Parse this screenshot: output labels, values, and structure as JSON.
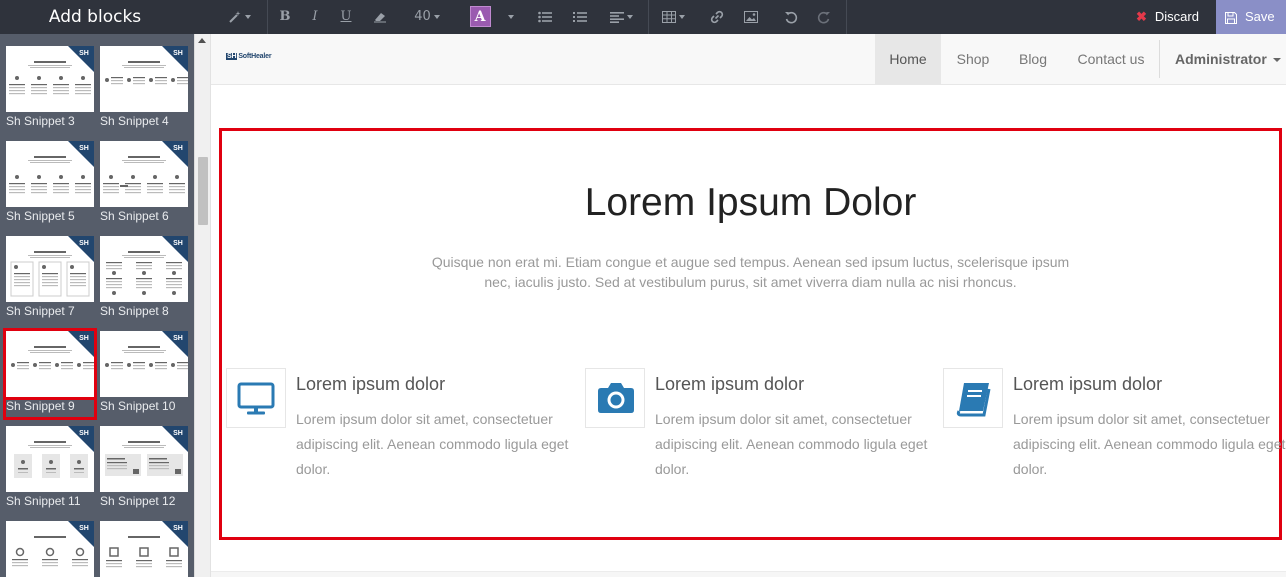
{
  "sidebar": {
    "title": "Add blocks",
    "snippets": [
      {
        "label": "Sh Snippet 3"
      },
      {
        "label": "Sh Snippet 4"
      },
      {
        "label": "Sh Snippet 5"
      },
      {
        "label": "Sh Snippet 6"
      },
      {
        "label": "Sh Snippet 7"
      },
      {
        "label": "Sh Snippet 8"
      },
      {
        "label": "Sh Snippet 9",
        "selected": true
      },
      {
        "label": "Sh Snippet 10"
      },
      {
        "label": "Sh Snippet 11"
      },
      {
        "label": "Sh Snippet 12"
      },
      {
        "label": ""
      },
      {
        "label": ""
      }
    ],
    "badge_text": "SH"
  },
  "toolbar": {
    "font_size": "40",
    "font_color_letter": "A",
    "discard_label": "Discard",
    "save_label": "Save",
    "colors": {
      "font_color": "#9a5bb0",
      "save_bg": "#8a8fc7",
      "discard_icon": "#e4394a"
    }
  },
  "navbar": {
    "logo_mark": "SH",
    "logo_text": "SoftHealer",
    "items": [
      {
        "label": "Home",
        "active": true
      },
      {
        "label": "Shop"
      },
      {
        "label": "Blog"
      },
      {
        "label": "Contact us"
      }
    ],
    "user_menu": "Administrator"
  },
  "block": {
    "title": "Lorem Ipsum Dolor",
    "text": "Quisque non erat mi. Etiam congue et augue sed tempus. Aenean sed ipsum luctus, scelerisque ipsum nec, iaculis justo. Sed at vestibulum purus, sit amet viverra diam nulla ac nisi rhoncus.",
    "features": [
      {
        "icon": "desktop-icon",
        "title": "Lorem ipsum dolor",
        "text": "Lorem ipsum dolor sit amet, consectetuer adipiscing elit. Aenean commodo ligula eget dolor."
      },
      {
        "icon": "camera-icon",
        "title": "Lorem ipsum dolor",
        "text": "Lorem ipsum dolor sit amet, consectetuer adipiscing elit. Aenean commodo ligula eget dolor."
      },
      {
        "icon": "book-icon",
        "title": "Lorem ipsum dolor",
        "text": "Lorem ipsum dolor sit amet, consectetuer adipiscing elit. Aenean commodo ligula eget dolor."
      }
    ],
    "colors": {
      "icon": "#2a7ab3",
      "selection_outline": "#e00010"
    }
  }
}
